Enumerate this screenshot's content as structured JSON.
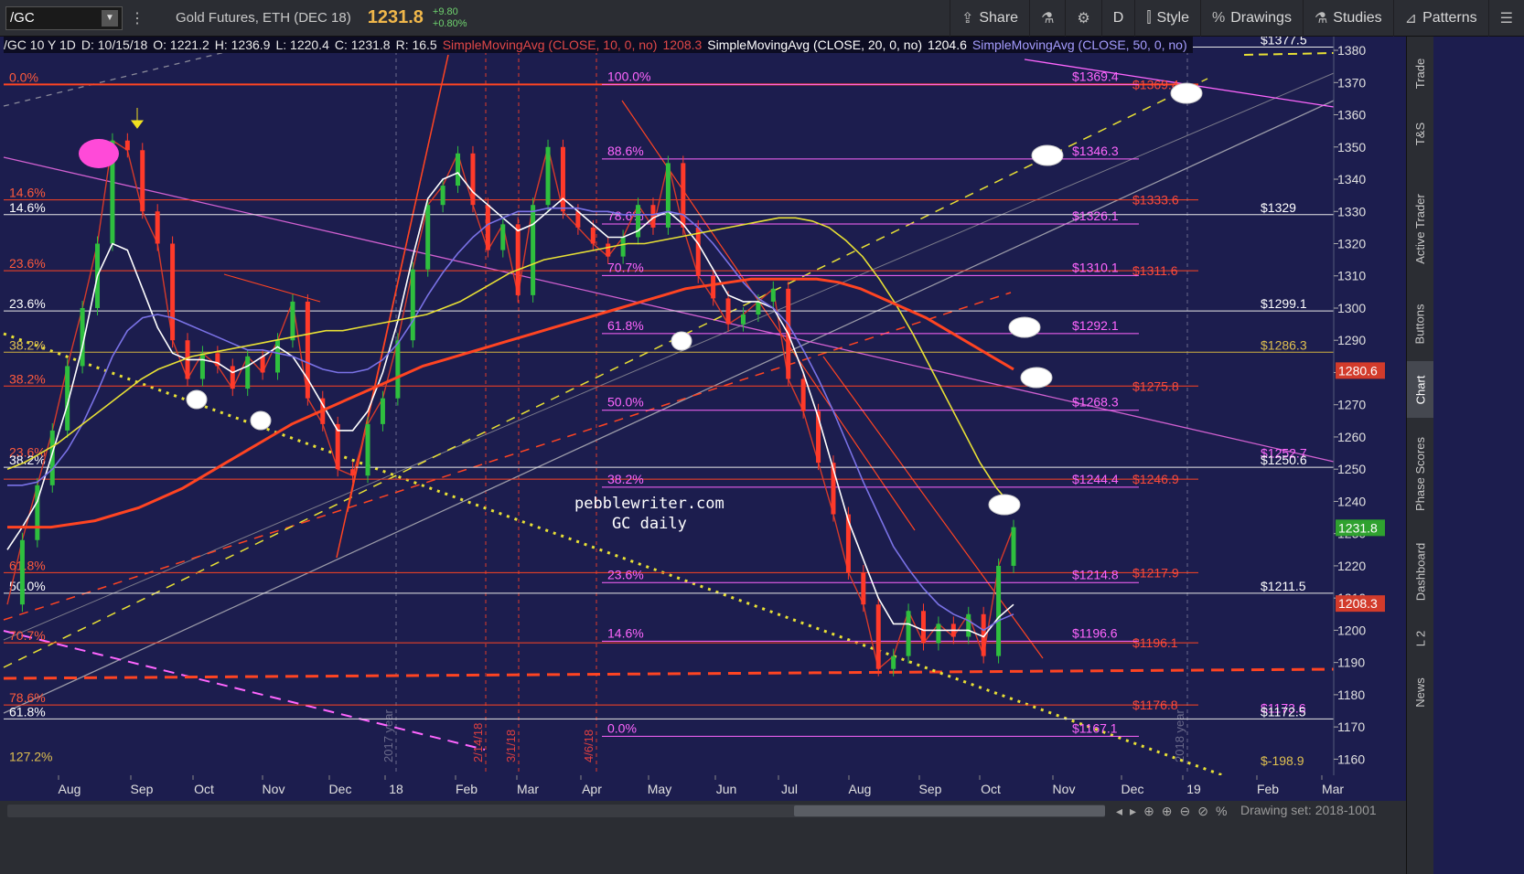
{
  "toolbar": {
    "symbol": "/GC",
    "contract": "Gold Futures, ETH (DEC 18)",
    "last": "1231.8",
    "change": "+9.80",
    "change_pct": "+0.80%",
    "share": "Share",
    "timeframe": "D",
    "style": "Style",
    "drawings": "Drawings",
    "studies": "Studies",
    "patterns": "Patterns"
  },
  "legend": {
    "header": "/GC 10 Y 1D",
    "date": "D: 10/15/18",
    "open": "O: 1221.2",
    "high": "H: 1236.9",
    "low": "L: 1220.4",
    "close": "C: 1231.8",
    "range": "R: 16.5",
    "sma10_label": "SimpleMovingAvg (CLOSE, 10, 0, no)",
    "sma10_value": "1208.3",
    "sma20_label": "SimpleMovingAvg (CLOSE, 20, 0, no)",
    "sma20_value": "1204.6",
    "sma50_label": "SimpleMovingAvg (CLOSE, 50, 0, no)"
  },
  "watermark": [
    "pebblewriter.com",
    "GC daily"
  ],
  "sidebar_tabs": [
    "Trade",
    "T&S",
    "Active Trader",
    "Buttons",
    "Chart",
    "Phase Scores",
    "Dashboard",
    "L 2",
    "News"
  ],
  "bottom": {
    "drawing_set": "Drawing set: 2018-1001"
  },
  "chart_data": {
    "type": "line",
    "title": "",
    "ylim": [
      1155,
      1382
    ],
    "y_ticks": [
      1160,
      1170,
      1180,
      1190,
      1200,
      1210,
      1220,
      1230,
      1240,
      1250,
      1260,
      1270,
      1280,
      1290,
      1300,
      1310,
      1320,
      1330,
      1340,
      1350,
      1360,
      1370,
      1380
    ],
    "x_tick_labels": [
      "Aug",
      "Sep",
      "Oct",
      "Nov",
      "Dec",
      "18",
      "Feb",
      "Mar",
      "Apr",
      "May",
      "Jun",
      "Jul",
      "Aug",
      "Sep",
      "Oct",
      "Nov",
      "Dec",
      "19",
      "Feb",
      "Mar"
    ],
    "price_badges": [
      {
        "text": "1280.6",
        "value": 1280.6,
        "color": "#d23b2b"
      },
      {
        "text": "1231.8",
        "value": 1231.8,
        "color": "#2fa12f"
      },
      {
        "text": "1208.3",
        "value": 1208.3,
        "color": "#d23b2b"
      }
    ],
    "fib_levels": [
      {
        "pct": "100.0%",
        "price": "$1369.4",
        "value": 1369.4,
        "color": "#ff66ff"
      },
      {
        "pct": "88.6%",
        "price": "$1346.3",
        "value": 1346.3,
        "color": "#ff66ff"
      },
      {
        "pct": "78.6%",
        "price": "$1326.1",
        "value": 1326.1,
        "color": "#ff66ff"
      },
      {
        "pct": "70.7%",
        "price": "$1310.1",
        "value": 1310.1,
        "color": "#ff66ff"
      },
      {
        "pct": "61.8%",
        "price": "$1292.1",
        "value": 1292.1,
        "color": "#ff66ff"
      },
      {
        "pct": "50.0%",
        "price": "$1268.3",
        "value": 1268.3,
        "color": "#ff66ff"
      },
      {
        "pct": "38.2%",
        "price": "$1244.4",
        "value": 1244.4,
        "color": "#ff66ff"
      },
      {
        "pct": "23.6%",
        "price": "$1214.8",
        "value": 1214.8,
        "color": "#ff66ff"
      },
      {
        "pct": "14.6%",
        "price": "$1196.6",
        "value": 1196.6,
        "color": "#ff66ff"
      },
      {
        "pct": "0.0%",
        "price": "$1167.1",
        "value": 1167.1,
        "color": "#ff66ff"
      }
    ],
    "red_levels": [
      {
        "price": "$1369.4",
        "value": 1369.4
      },
      {
        "price": "$1333.6",
        "value": 1333.6
      },
      {
        "price": "$1311.6",
        "value": 1311.6
      },
      {
        "price": "$1275.8",
        "value": 1275.8
      },
      {
        "price": "$1246.9",
        "value": 1246.9
      },
      {
        "price": "$1217.9",
        "value": 1217.9
      },
      {
        "price": "$1196.1",
        "value": 1196.1
      },
      {
        "price": "$1176.8",
        "value": 1176.8
      }
    ],
    "left_fib_labels": [
      {
        "text": "0.0%",
        "value": 1369.4,
        "color": "#ff5a3c"
      },
      {
        "text": "14.6%",
        "value": 1333.6,
        "color": "#ff5a3c"
      },
      {
        "text": "14.6%",
        "value": 1329,
        "color": "#ffffff"
      },
      {
        "text": "23.6%",
        "value": 1311.6,
        "color": "#ff5a3c"
      },
      {
        "text": "23.6%",
        "value": 1299.1,
        "color": "#ffffff"
      },
      {
        "text": "38.2%",
        "value": 1286.3,
        "color": "#e0c050"
      },
      {
        "text": "38.2%",
        "value": 1275.8,
        "color": "#ff5a3c"
      },
      {
        "text": "23.6%",
        "value": 1253,
        "color": "#ff5a3c"
      },
      {
        "text": "38.2%",
        "value": 1250.6,
        "color": "#ffffff"
      },
      {
        "text": "61.8%",
        "value": 1217.9,
        "color": "#ff5a3c"
      },
      {
        "text": "50.0%",
        "value": 1211.5,
        "color": "#ffffff"
      },
      {
        "text": "70.7%",
        "value": 1196.1,
        "color": "#ff5a3c"
      },
      {
        "text": "78.6%",
        "value": 1176.8,
        "color": "#ff5a3c"
      },
      {
        "text": "61.8%",
        "value": 1172.5,
        "color": "#ffffff"
      },
      {
        "text": "127.2%",
        "value": 1158.5,
        "color": "#e0c050"
      }
    ],
    "right_labels": [
      {
        "text": "$1329",
        "value": 1329,
        "color": "#ffffff"
      },
      {
        "text": "$1299.1",
        "value": 1299.1,
        "color": "#ffffff"
      },
      {
        "text": "$1286.3",
        "value": 1286.3,
        "color": "#e0c050"
      },
      {
        "text": "$1252.7",
        "value": 1252.7,
        "color": "#ff66ff"
      },
      {
        "text": "$1250.6",
        "value": 1250.6,
        "color": "#ffffff"
      },
      {
        "text": "$1211.5",
        "value": 1211.5,
        "color": "#ffffff"
      },
      {
        "text": "$1173.6",
        "value": 1173.6,
        "color": "#ff66ff"
      },
      {
        "text": "$1172.5",
        "value": 1172.5,
        "color": "#ffffff"
      },
      {
        "text": "$-198.9",
        "value": 1157.2,
        "color": "#e0c050"
      },
      {
        "text": "$1377.5",
        "value": 1381,
        "color": "#ffffff"
      }
    ],
    "vertical_markers": [
      "2017 year",
      "2/14/18",
      "3/1/18",
      "4/6/18",
      "2018 year"
    ],
    "series": [
      {
        "name": "Price",
        "color": "#d63a2a",
        "values": [
          1208,
          1228,
          1245,
          1262,
          1282,
          1300,
          1320,
          1352,
          1349,
          1330,
          1320,
          1290,
          1278,
          1286,
          1282,
          1275,
          1285,
          1280,
          1290,
          1302,
          1272,
          1264,
          1250,
          1248,
          1264,
          1272,
          1290,
          1312,
          1332,
          1338,
          1348,
          1332,
          1318,
          1326,
          1304,
          1332,
          1350,
          1330,
          1325,
          1320,
          1316,
          1322,
          1332,
          1325,
          1345,
          1325,
          1310,
          1303,
          1295,
          1298,
          1302,
          1306,
          1278,
          1268,
          1252,
          1236,
          1218,
          1208,
          1188,
          1192,
          1206,
          1196,
          1202,
          1198,
          1205,
          1192,
          1220,
          1232
        ]
      },
      {
        "name": "SMA10",
        "color": "#ffffff",
        "values": [
          1225,
          1232,
          1240,
          1255,
          1270,
          1288,
          1310,
          1320,
          1318,
          1306,
          1294,
          1286,
          1284,
          1284,
          1283,
          1280,
          1282,
          1285,
          1288,
          1285,
          1278,
          1270,
          1262,
          1262,
          1268,
          1280,
          1296,
          1316,
          1334,
          1340,
          1342,
          1336,
          1332,
          1328,
          1324,
          1326,
          1330,
          1334,
          1330,
          1326,
          1322,
          1322,
          1324,
          1328,
          1330,
          1326,
          1320,
          1312,
          1304,
          1302,
          1302,
          1300,
          1292,
          1280,
          1266,
          1250,
          1234,
          1222,
          1210,
          1202,
          1202,
          1200,
          1200,
          1200,
          1200,
          1198,
          1204,
          1208
        ]
      },
      {
        "name": "SMA50",
        "color": "#7a72e6",
        "values": [
          1245,
          1245,
          1246,
          1250,
          1256,
          1264,
          1274,
          1285,
          1293,
          1297,
          1298,
          1297,
          1295,
          1293,
          1291,
          1289,
          1287,
          1287,
          1286,
          1285,
          1283,
          1281,
          1280,
          1280,
          1281,
          1284,
          1289,
          1296,
          1304,
          1311,
          1317,
          1322,
          1326,
          1328,
          1330,
          1330,
          1331,
          1331,
          1331,
          1330,
          1330,
          1329,
          1329,
          1329,
          1330,
          1329,
          1325,
          1320,
          1314,
          1308,
          1303,
          1300,
          1295,
          1287,
          1278,
          1268,
          1257,
          1246,
          1236,
          1226,
          1219,
          1213,
          1208,
          1205,
          1203,
          1200,
          1203,
          1205
        ]
      },
      {
        "name": "SMA100",
        "color": "#e8e035",
        "values": [
          1250,
          1252,
          1255,
          1258,
          1262,
          1266,
          1270,
          1274,
          1278,
          1281,
          1283,
          1285,
          1286,
          1287,
          1288,
          1289,
          1290,
          1291,
          1292,
          1293,
          1293,
          1294,
          1295,
          1296,
          1297,
          1298,
          1300,
          1302,
          1305,
          1308,
          1311,
          1313,
          1315,
          1316,
          1317,
          1318,
          1319,
          1320,
          1320,
          1321,
          1322,
          1323,
          1324,
          1325,
          1326,
          1327,
          1328,
          1328,
          1327,
          1325,
          1321,
          1316,
          1309,
          1301,
          1292,
          1282,
          1272,
          1262,
          1252,
          1244,
          1238
        ]
      },
      {
        "name": "SMA200",
        "color": "#ff4422",
        "values": [
          1232,
          1232,
          1232,
          1233,
          1234,
          1236,
          1238,
          1241,
          1244,
          1248,
          1252,
          1256,
          1260,
          1264,
          1267,
          1270,
          1273,
          1276,
          1279,
          1282,
          1284,
          1286,
          1288,
          1290,
          1292,
          1294,
          1296,
          1298,
          1300,
          1302,
          1304,
          1306,
          1307,
          1308,
          1309,
          1309,
          1309,
          1309,
          1308,
          1306,
          1303,
          1300,
          1297,
          1293,
          1289,
          1285,
          1281
        ]
      }
    ]
  }
}
